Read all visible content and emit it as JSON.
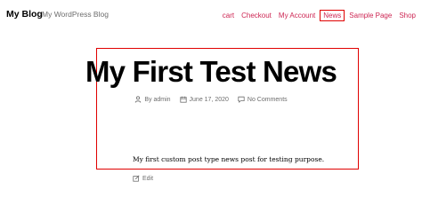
{
  "header": {
    "site_title": "My Blog",
    "site_description": "My WordPress Blog"
  },
  "nav": {
    "items": [
      {
        "label": "cart"
      },
      {
        "label": "Checkout"
      },
      {
        "label": "My Account"
      },
      {
        "label": "News",
        "active": true
      },
      {
        "label": "Sample Page"
      },
      {
        "label": "Shop"
      }
    ]
  },
  "post": {
    "title": "My First Test News",
    "author": "By admin",
    "date": "June 17, 2020",
    "comments": "No Comments",
    "content": "My first custom post type news post for testing purpose.",
    "edit_label": "Edit"
  },
  "colors": {
    "link": "#cd2653",
    "highlight_border": "#e00000",
    "meta_text": "#6d6d6d"
  },
  "icons": {
    "author": "person-icon",
    "date": "calendar-icon",
    "comments": "comment-icon",
    "edit": "edit-icon"
  }
}
